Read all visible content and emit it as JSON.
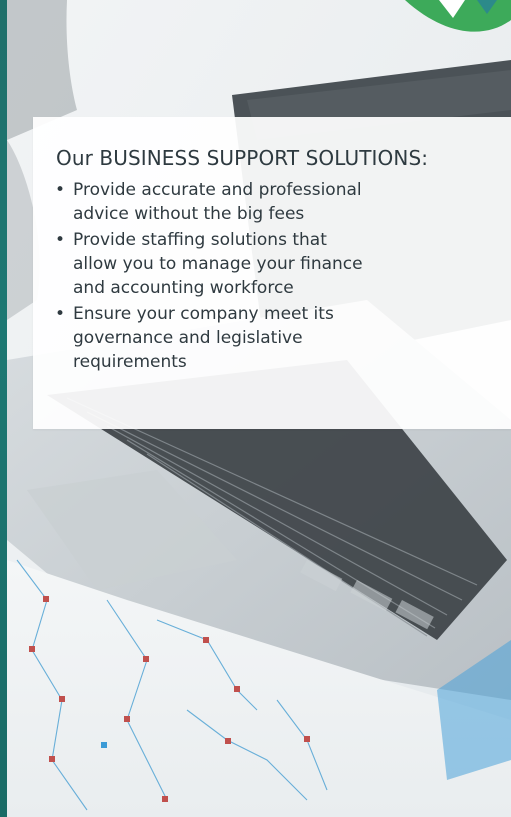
{
  "card": {
    "title": "Our BUSINESS SUPPORT SOLUTIONS:",
    "bullets": [
      {
        "marker": "•",
        "text": "Provide accurate and professional\nadvice without the big fees"
      },
      {
        "marker": "•",
        "text": "Provide staffing solutions that\nallow you to manage your finance\nand accounting workforce"
      },
      {
        "marker": "•",
        "text": "Ensure your company meet  its\ngovernance and legislative\nrequirements"
      }
    ]
  },
  "colors": {
    "accent_teal": "#1d7873",
    "logo_green": "#3daa5a",
    "text": "#2f3a40",
    "chart_marker_red": "#c0504d",
    "chart_marker_blue": "#3b9bd6"
  },
  "icons": {
    "logo": "v-logo-icon"
  }
}
